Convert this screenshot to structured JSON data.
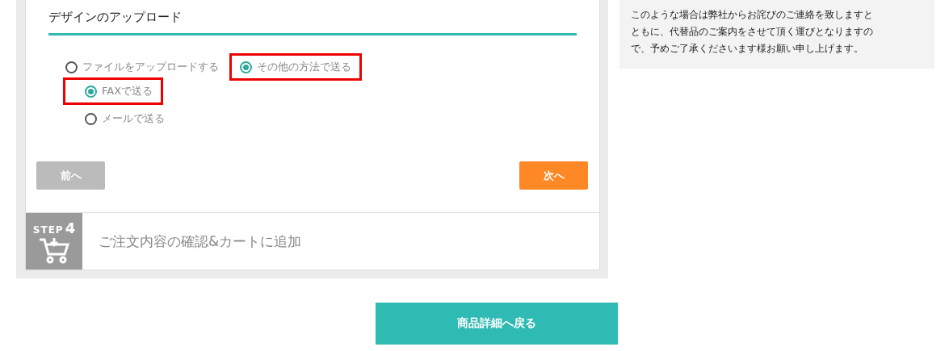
{
  "upload_section": {
    "title": "デザインのアップロード",
    "options": [
      {
        "label": "ファイルをアップロードする",
        "selected": false,
        "highlighted": false
      },
      {
        "label": "その他の方法で送る",
        "selected": true,
        "highlighted": true,
        "children": [
          {
            "label": "FAXで送る",
            "selected": true,
            "highlighted": true
          },
          {
            "label": "メールで送る",
            "selected": false,
            "highlighted": false
          }
        ]
      }
    ],
    "prev_button": "前へ",
    "next_button": "次へ"
  },
  "step": {
    "badge": "STEP",
    "number": "4",
    "title": "ご注文内容の確認&カートに追加"
  },
  "back_button": "商品詳細へ戻る",
  "notice": {
    "lines": [
      "このような場合は弊社からお詫びのご連絡を致しますと",
      "ともに、代替品のご案内をさせて頂く運びとなりますの",
      "で、予めご了承くださいます様お願い申し上げます。"
    ]
  }
}
